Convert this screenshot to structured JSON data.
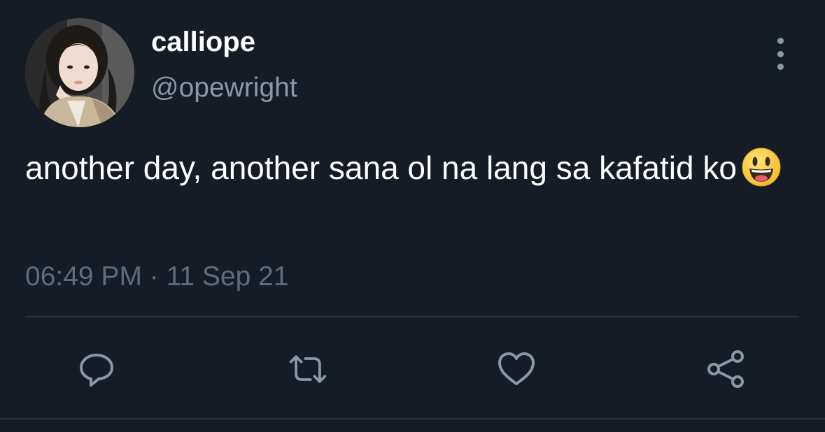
{
  "user": {
    "display_name": "calliope",
    "handle": "@opewright"
  },
  "tweet": {
    "text": "another day, another sana ol na lang sa kafatid ko",
    "emoji": "grinning-face-emoji",
    "timestamp": "06:49 PM · 11 Sep 21"
  },
  "actions": {
    "reply_icon": "reply-icon",
    "retweet_icon": "retweet-icon",
    "like_icon": "heart-icon",
    "share_icon": "share-icon"
  },
  "colors": {
    "background": "#151c25",
    "text": "#ffffff",
    "secondary_text": "#8899a6",
    "icon": "#8899a6",
    "divider": "#2b3642"
  }
}
